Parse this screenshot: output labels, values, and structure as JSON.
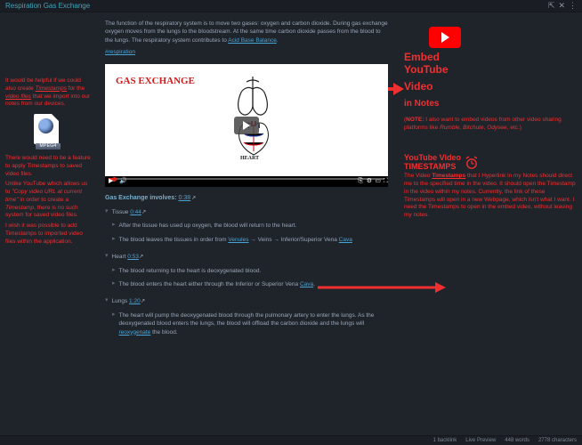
{
  "titlebar": {
    "title": "Respiration Gas Exchange"
  },
  "content": {
    "intro": "The function of the respiratory system is to move two gases: oxygen and carbon dioxide. During gas exchange oxygen moves from the lungs to the bloodstream. At the same time carbon dioxide passes from the blood to the lungs. The respiratory system contributes to ",
    "intro_link": "Acid Base Balance",
    "hashtag": "#respiration",
    "video": {
      "title_overlay": "GAS EXCHANGE",
      "heart_label": "HEART"
    },
    "exchange": {
      "label": "Gas Exchange involves:",
      "ts": "0:38"
    },
    "tissue": {
      "label": "Tissue",
      "ts": "0:44",
      "b1": "After the tissue has used up oxygen, the blood will return to the heart.",
      "b2_pre": "The blood leaves the tissues in order from ",
      "b2_l1": "Venules",
      "b2_mid": " → Veins → Inferior/Superior Vena ",
      "b2_l2": "Cava"
    },
    "heart": {
      "label": "Heart",
      "ts": "0:53",
      "b1": "The blood returning to the heart is deoxygenated blood.",
      "b2_pre": "The blood enters the heart either through the Inferior or Superior Vena ",
      "b2_l1": "Cava",
      "b2_post": "."
    },
    "lungs": {
      "label": "Lungs",
      "ts": "1:20",
      "b1_pre": "The heart will pump the deoxygenated blood through the pulmonary artery to enter the lungs. As the deoxygenated blood enters the lungs, the blood will offload the carbon dioxide and the lungs will ",
      "b1_link": "reoxygenate",
      "b1_post": " the blood."
    }
  },
  "left_margin": {
    "p1_pre": "It would be helpful if we could also create ",
    "p1_u1": "Timestamps",
    "p1_mid": " for the ",
    "p1_u2": "video files",
    "p1_post": " that we import into our notes from our devices.",
    "file_icon_label": "MPEG4",
    "p2": "There would need to be a feature to apply Timestamps to saved video files.",
    "p3_pre": "Unlike YouTube which allows us to ",
    "p3_q": "\"Copy video URL at current time\"",
    "p3_mid": " in order to create a ",
    "p3_i": "Timestamp",
    "p3_post": ", there is no such system for saved video files.",
    "p4": "I wish it was possible to add Timestamps to imported video files within the application."
  },
  "right_margin": {
    "h1a": "Embed",
    "h1b": "YouTube",
    "h1c": "Video",
    "h2": "in Notes",
    "note_pre": "(",
    "note_b": "NOTE:",
    "note_body": " I also want to embed videos from other video sharing platforms like ",
    "note_i": "Rumble, Bitchute, Odysee",
    "note_post": ", etc.)",
    "ts_title_a": "YouTube Video",
    "ts_title_b": "TIMESTAMPS",
    "ts_body_pre": "The Video ",
    "ts_body_u": "Timestamps",
    "ts_body": " that I Hyperlink in my Notes should direct me to the specified time in the video. It should open the Timestamp in the video within my notes. Currently, the link of these Timestamps will open in a new Webpage, which isn't what I want. I need the Timestamps to open in the embed video, without leaving my notes."
  },
  "statusbar": {
    "backlinks": "1 backlink",
    "preview": "Live Preview",
    "words": "448 words",
    "chars": "2778 characters"
  }
}
